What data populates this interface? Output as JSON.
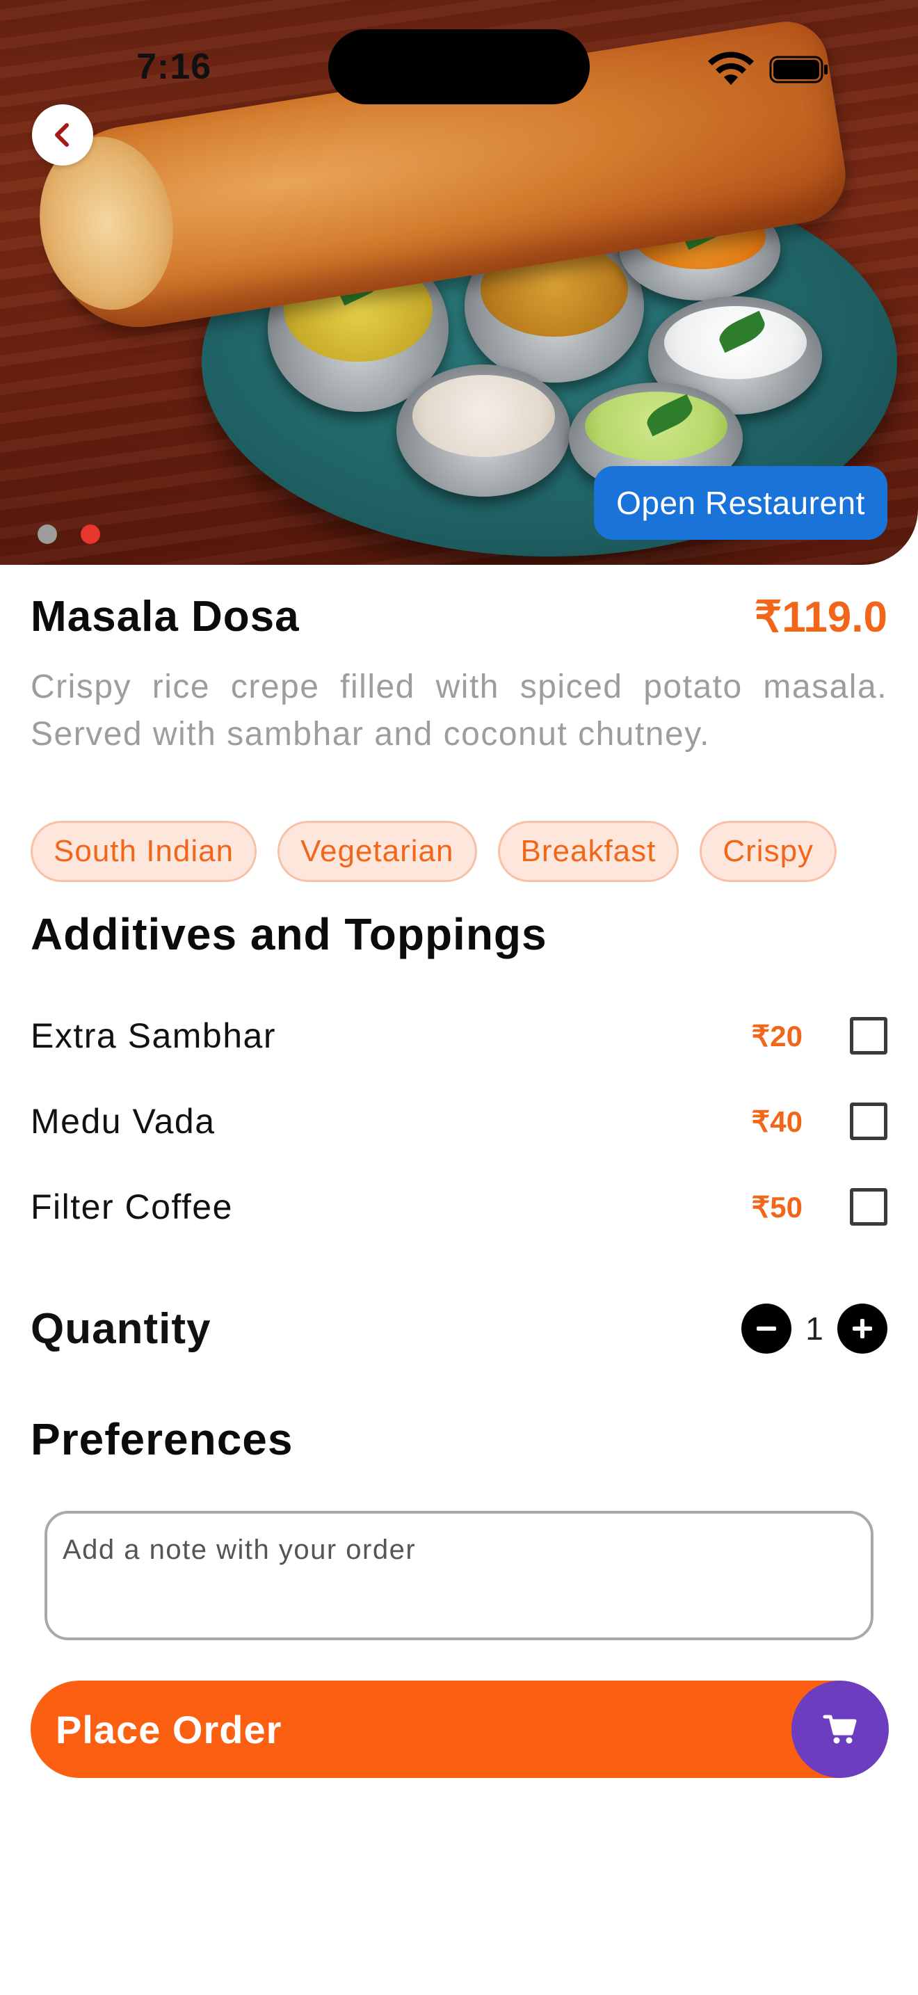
{
  "status_bar": {
    "time": "7:16"
  },
  "hero": {
    "image_icon": "dosa-thali-photo",
    "open_restaurant_label": "Open Restaurent",
    "carousel_count": 2,
    "carousel_active": 2
  },
  "dish": {
    "name": "Masala Dosa",
    "price": "₹119.0",
    "description": "Crispy rice crepe filled with spiced potato masala. Served with sambhar and coconut chutney.",
    "tags": [
      "South Indian",
      "Vegetarian",
      "Breakfast",
      "Crispy"
    ]
  },
  "addons": {
    "title": "Additives and Toppings",
    "items": [
      {
        "name": "Extra Sambhar",
        "price": "₹20",
        "checked": false
      },
      {
        "name": "Medu Vada",
        "price": "₹40",
        "checked": false
      },
      {
        "name": "Filter Coffee",
        "price": "₹50",
        "checked": false
      }
    ]
  },
  "quantity": {
    "label": "Quantity",
    "value": "1"
  },
  "preferences": {
    "title": "Preferences",
    "placeholder": "Add a note with your order"
  },
  "order": {
    "label": "Place Order",
    "cart_icon": "cart-icon"
  },
  "colors": {
    "accent": "#fa5f12",
    "price": "#f2661a",
    "tag_bg": "#fde7dc",
    "button_blue": "#1a73d9",
    "cart_purple": "#6c3ebf",
    "dot_active": "#e8362e"
  }
}
